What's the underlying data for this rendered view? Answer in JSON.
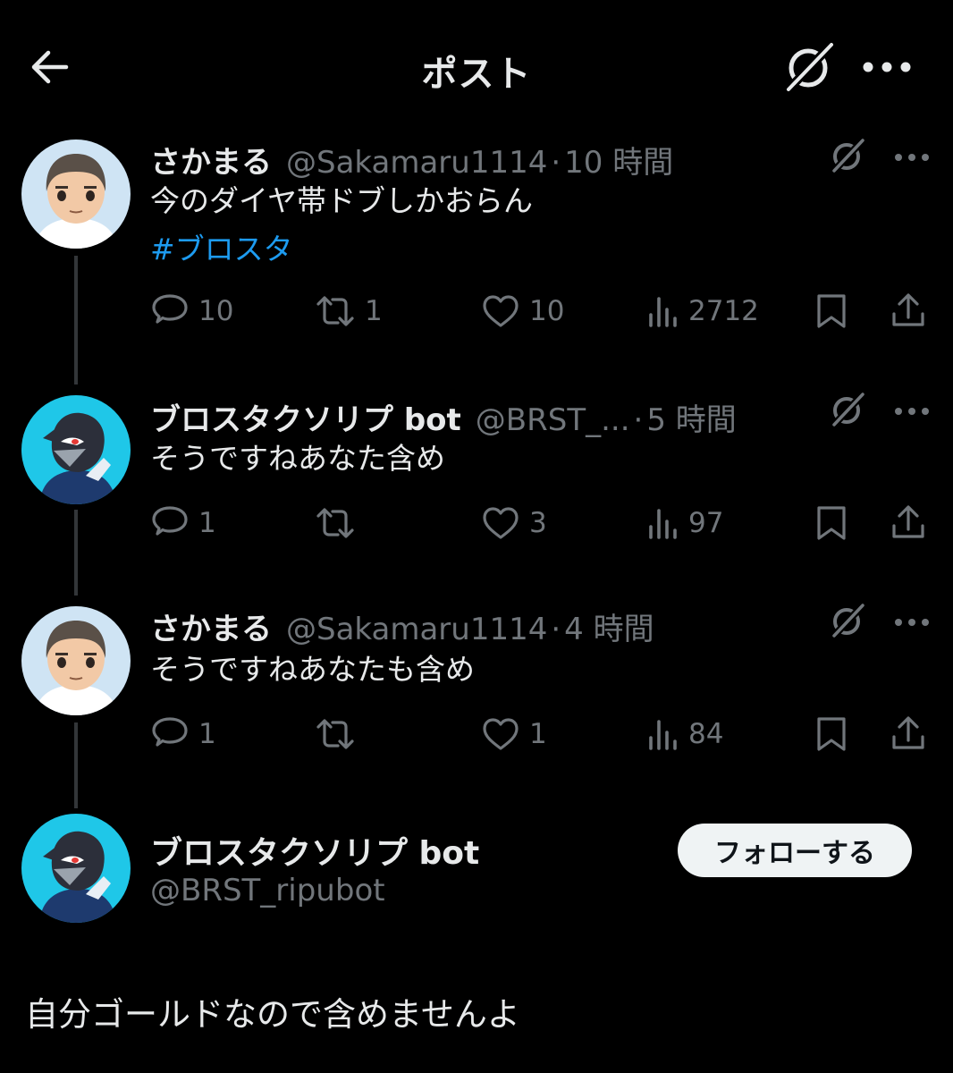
{
  "header": {
    "title": "ポスト",
    "back_icon": "arrow-left-icon",
    "grok_icon": "grok-icon",
    "more_icon": "more-horizontal-icon"
  },
  "thread": [
    {
      "display_name": "さかまる",
      "handle": "@Sakamaru1114",
      "separator": "·",
      "time": "10 時間",
      "text_line1": "今のダイヤ帯ドブしかおらん",
      "hashtag": "#ブロスタ",
      "avatar": "avatar-boy-white-shirt",
      "actions": {
        "reply": "10",
        "repost": "1",
        "like": "10",
        "views": "2712"
      }
    },
    {
      "display_name": "ブロスタクソリプ bot",
      "handle": "@BRST_...",
      "separator": "·",
      "time": "5 時間",
      "text_line1": "そうですねあなた含め",
      "avatar": "avatar-crow-character",
      "actions": {
        "reply": "1",
        "repost": "",
        "like": "3",
        "views": "97"
      }
    },
    {
      "display_name": "さかまる",
      "handle": "@Sakamaru1114",
      "separator": "·",
      "time": "4 時間",
      "text_line1": "そうですねあなたも含め",
      "avatar": "avatar-boy-white-shirt",
      "actions": {
        "reply": "1",
        "repost": "",
        "like": "1",
        "views": "84"
      }
    }
  ],
  "main_post": {
    "display_name": "ブロスタクソリプ bot",
    "handle": "@BRST_ripubot",
    "follow_label": "フォローする",
    "text": "自分ゴールドなので含めませんよ",
    "avatar": "avatar-crow-character"
  },
  "colors": {
    "background": "#000000",
    "text_primary": "#e7e9ea",
    "text_secondary": "#71767b",
    "link": "#1d9bf0",
    "thread_line": "#333639",
    "follow_button_bg": "#eff3f4"
  }
}
